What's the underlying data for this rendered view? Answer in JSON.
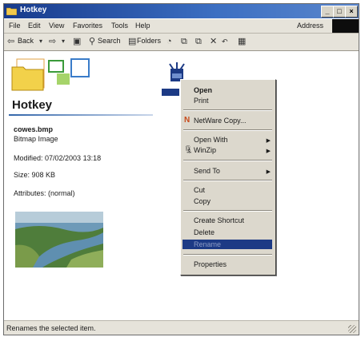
{
  "window": {
    "title": "Hotkey"
  },
  "menubar": {
    "items": [
      "File",
      "Edit",
      "View",
      "Favorites",
      "Tools",
      "Help"
    ],
    "address_label": "Address"
  },
  "toolbar": {
    "back": "Back",
    "search": "Search",
    "folders": "Folders"
  },
  "left_panel": {
    "folder_name": "Hotkey",
    "file_name": "cowes.bmp",
    "file_type": "Bitmap Image",
    "modified": "Modified: 07/02/2003 13:18",
    "size": "Size: 908 KB",
    "attributes": "Attributes: (normal)"
  },
  "context_menu": {
    "open": "Open",
    "print": "Print",
    "netware_copy": "NetWare Copy...",
    "open_with": "Open With",
    "winzip": "WinZip",
    "send_to": "Send To",
    "cut": "Cut",
    "copy": "Copy",
    "create_shortcut": "Create Shortcut",
    "delete": "Delete",
    "rename": "Rename",
    "properties": "Properties"
  },
  "statusbar": {
    "text": "Renames the selected item."
  },
  "colors": {
    "titlebar": "#173a8c",
    "menu_highlight": "#1c3a85",
    "chrome": "#e6e3da"
  }
}
